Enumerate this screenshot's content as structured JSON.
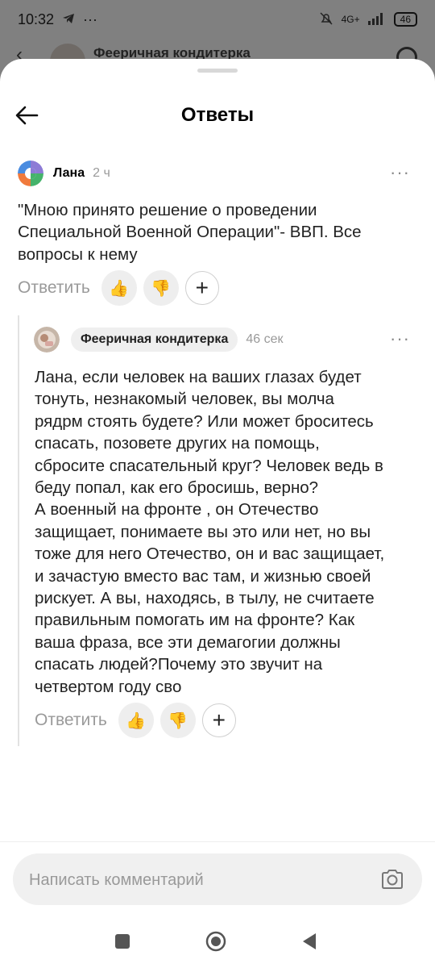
{
  "status": {
    "time": "10:32",
    "battery": "46",
    "network": "4G+"
  },
  "behind": {
    "title": "Фееричная кондитерка"
  },
  "sheet": {
    "title": "Ответы"
  },
  "comment1": {
    "author": "Лана",
    "time": "2 ч",
    "lines": [
      "\"Мною принято решение о проведении",
      "Специальной Военной Операции\"- ВВП. Все",
      "вопросы к нему"
    ],
    "reply_label": "Ответить"
  },
  "comment2": {
    "author": "Фееричная кондитерка",
    "time": "46 сек",
    "lines": [
      "Лана, если человек на ваших глазах будет",
      "тонуть, незнакомый человек, вы молча",
      "рядрм стоять будете? Или может броситесь",
      "спасать, позовете других на помощь,",
      "сбросите спасательный круг? Человек ведь в",
      "беду попал, как его бросишь, верно?",
      "А военный на фронте , он Отечество",
      "защищает, понимаете вы это или нет, но вы",
      "тоже для него Отечество, он и вас защищает,",
      "и зачастую вместо вас там, и жизнью своей",
      "рискует. А вы, находясь, в тылу, не считаете",
      "правильным помогать им на фронте? Как",
      "ваша фраза, все эти демагогии должны",
      "спасать людей?Почему это звучит на",
      "четвертом году сво"
    ],
    "reply_label": "Ответить"
  },
  "composer": {
    "placeholder": "Написать комментарий"
  },
  "icons": {
    "back": "arrow-left-icon",
    "like": "thumbs-up-icon",
    "dislike": "thumbs-down-icon",
    "add": "plus-icon",
    "more": "more-dots-icon",
    "camera": "camera-icon"
  },
  "colors": {
    "accent_like": "#f5a623",
    "muted_text": "#9a9a9a",
    "bubble": "#eeeeee"
  }
}
